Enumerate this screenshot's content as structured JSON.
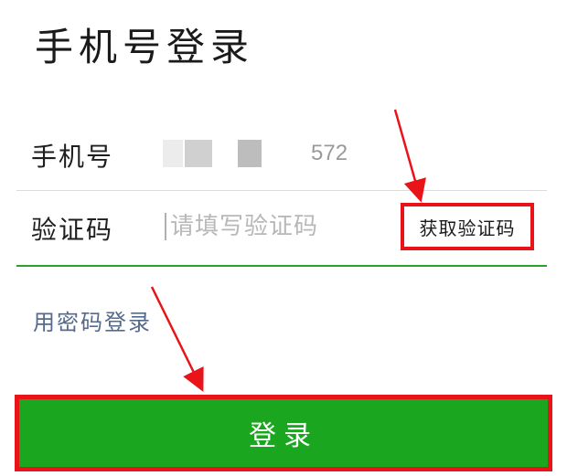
{
  "header": {
    "title": "手机号登录"
  },
  "form": {
    "phone_label": "手机号",
    "phone_value_tail": "572",
    "code_label": "验证码",
    "code_placeholder": "请填写验证码",
    "get_code_label": "获取验证码"
  },
  "links": {
    "password_login": "用密码登录"
  },
  "actions": {
    "login_label": "登录"
  },
  "colors": {
    "accent_green": "#1aa61e",
    "divider_green": "#2ba02b",
    "highlight_red": "#e8141a",
    "link_blue": "#566a8c"
  },
  "annotations": {
    "arrows": [
      "arrow-to-get-code",
      "arrow-to-login"
    ]
  }
}
